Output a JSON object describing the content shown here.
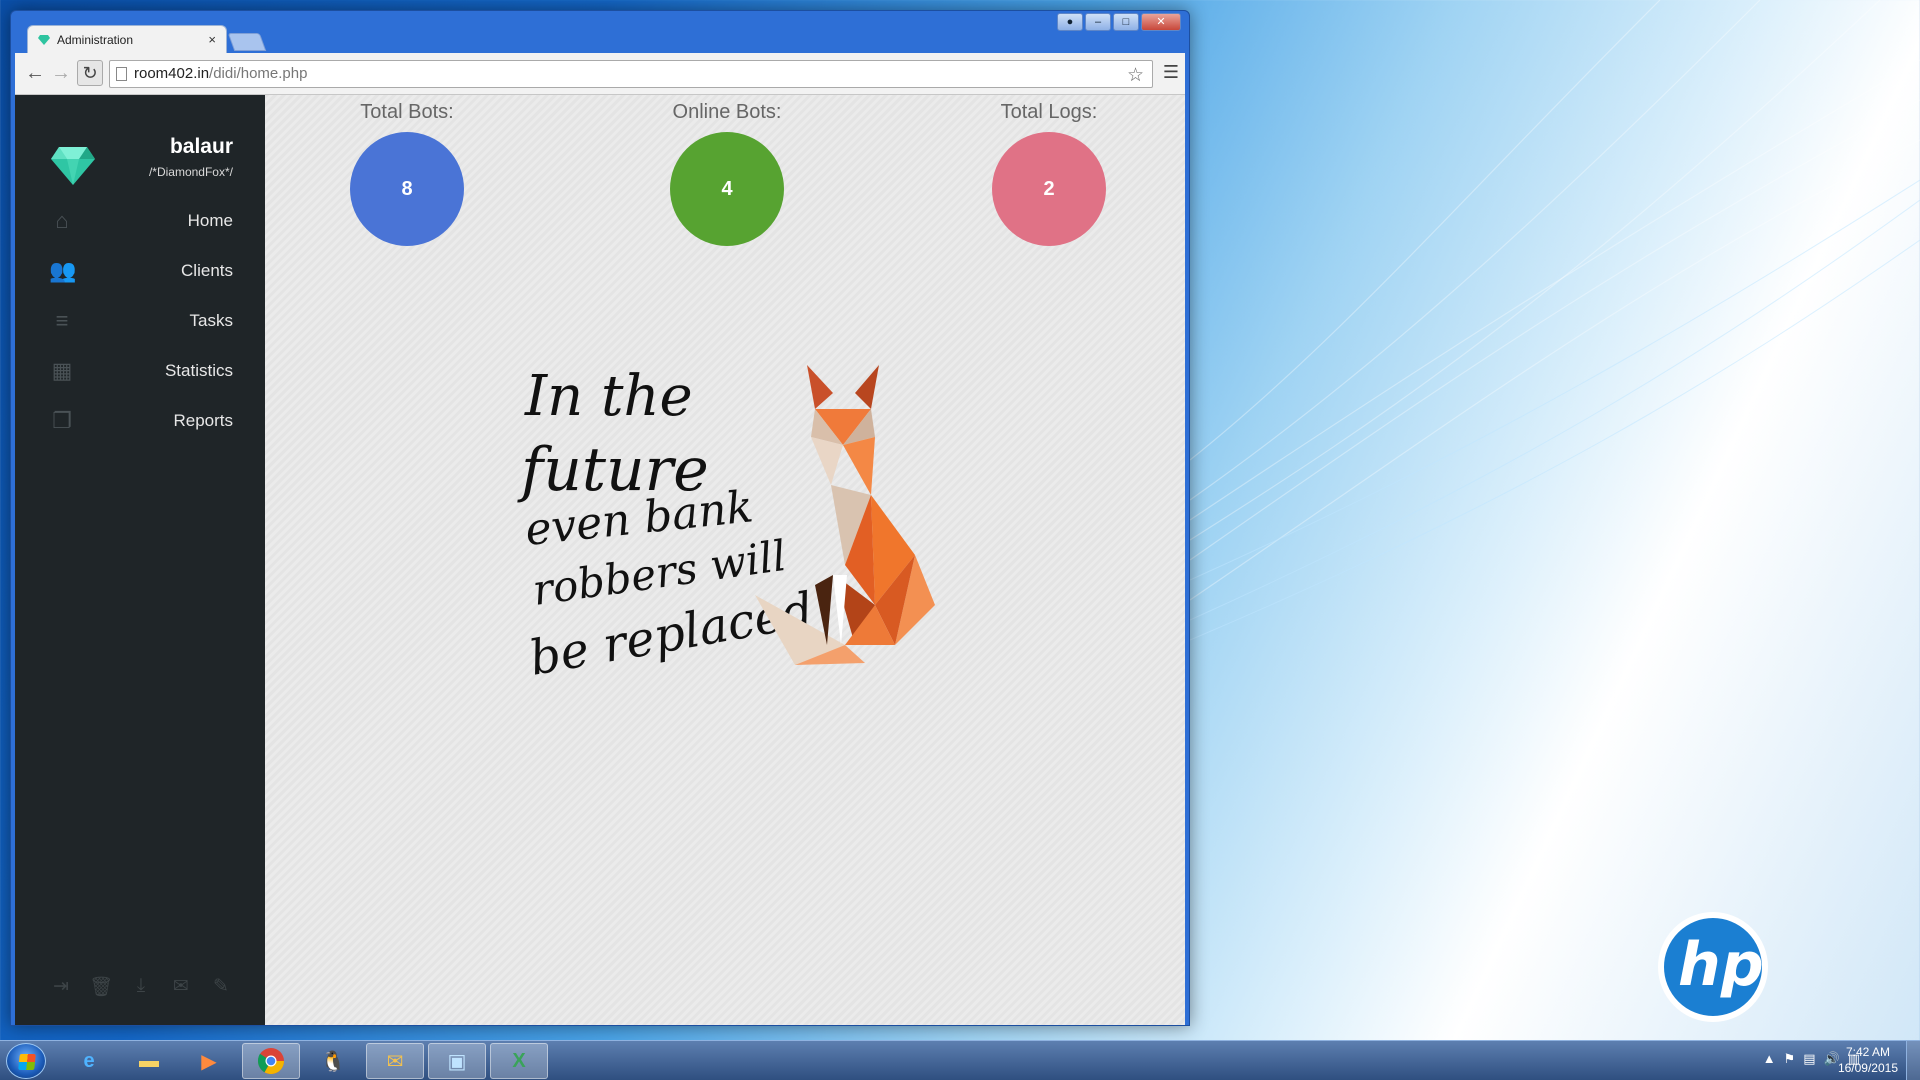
{
  "browser": {
    "tab_title": "Administration",
    "tab_close": "×",
    "url_host": "room402.in",
    "url_path": "/didi/home.php"
  },
  "sidebar": {
    "brand_name": "balaur",
    "brand_sub": "/*DiamondFox*/",
    "items": [
      {
        "label": "Home",
        "icon": "home-icon"
      },
      {
        "label": "Clients",
        "icon": "users-icon"
      },
      {
        "label": "Tasks",
        "icon": "tasks-icon"
      },
      {
        "label": "Statistics",
        "icon": "grid-icon"
      },
      {
        "label": "Reports",
        "icon": "copy-icon"
      }
    ],
    "footer_icons": [
      "logout-icon",
      "trash-icon",
      "download-icon",
      "mail-icon",
      "edit-icon"
    ]
  },
  "stats": [
    {
      "title": "Total Bots:",
      "value": "8",
      "color": "#4a74d6"
    },
    {
      "title": "Online Bots:",
      "value": "4",
      "color": "#57a331"
    },
    {
      "title": "Total Logs:",
      "value": "2",
      "color": "#e07286"
    }
  ],
  "artwork": {
    "lines": [
      "In the",
      "future",
      "even bank",
      "robbers will",
      "be replaced"
    ]
  },
  "taskbar": {
    "time": "7:42 AM",
    "date": "16/09/2015"
  },
  "desktop": {
    "logo_text": "hp"
  }
}
